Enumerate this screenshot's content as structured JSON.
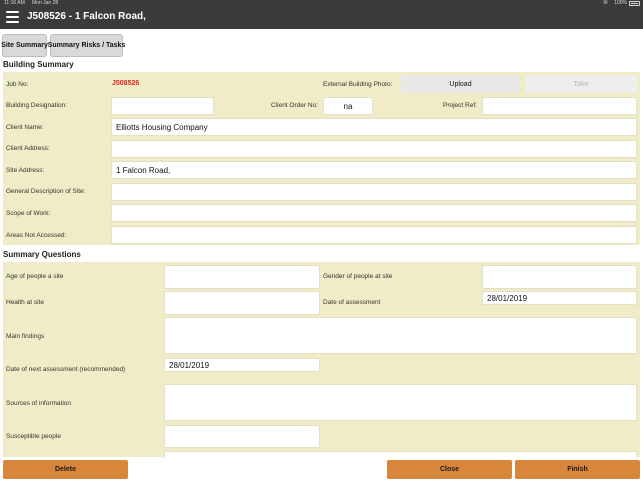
{
  "status_bar": {
    "time": "11:16 AM",
    "date": "Mon Jan 28",
    "battery": "100%",
    "wifi_icon": "wifi-icon",
    "battery_icon": "battery-icon"
  },
  "nav": {
    "title": "J508526 - 1 Falcon Road,",
    "menu_icon": "hamburger-menu-icon"
  },
  "tabs": {
    "site_summary": "Site Summary",
    "summary_risks": "Summary Risks / Tasks"
  },
  "building_summary": {
    "title": "Building Summary",
    "job_no_label": "Job No:",
    "job_no_value": "J508526",
    "external_photo_label": "External Building Photo:",
    "upload_label": "Upload",
    "take_label": "Take",
    "building_designation_label": "Building Designation:",
    "building_designation_value": "",
    "client_order_no_label": "Client Order No:",
    "client_order_no_value": "na",
    "project_ref_label": "Project Ref:",
    "project_ref_value": "",
    "client_name_label": "Client Name:",
    "client_name_value": "Elliotts Housing Company",
    "client_address_label": "Client Address:",
    "client_address_value": "",
    "site_address_label": "Site Address:",
    "site_address_value": "1 Falcon Road,",
    "general_description_label": "General Description of Site:",
    "general_description_value": "",
    "scope_of_work_label": "Scope of Work:",
    "scope_of_work_value": "",
    "areas_not_accessed_label": "Areas Not Accessed:",
    "areas_not_accessed_value": ""
  },
  "summary_questions": {
    "title": "Summary Questions",
    "age_label": "Age of people a site",
    "age_value": "",
    "gender_label": "Gender of people at site",
    "gender_value": "",
    "health_label": "Health at site",
    "health_value": "",
    "date_assessment_label": "Date of assessment",
    "date_assessment_value": "28/01/2019",
    "main_findings_label": "Main findings",
    "main_findings_value": "",
    "next_assessment_label": "Date of next assessment (recommended)",
    "next_assessment_value": "28/01/2019",
    "sources_label": "Sources of information",
    "sources_value": "",
    "susceptible_label": "Susceptible people",
    "susceptible_value": ""
  },
  "footer": {
    "delete_label": "Delete",
    "close_label": "Close",
    "finish_label": "Finish"
  },
  "colors": {
    "navbar": "#3b3b3b",
    "panel": "#f0ecc7",
    "button": "#d8863c",
    "job_no": "#e0281c"
  }
}
